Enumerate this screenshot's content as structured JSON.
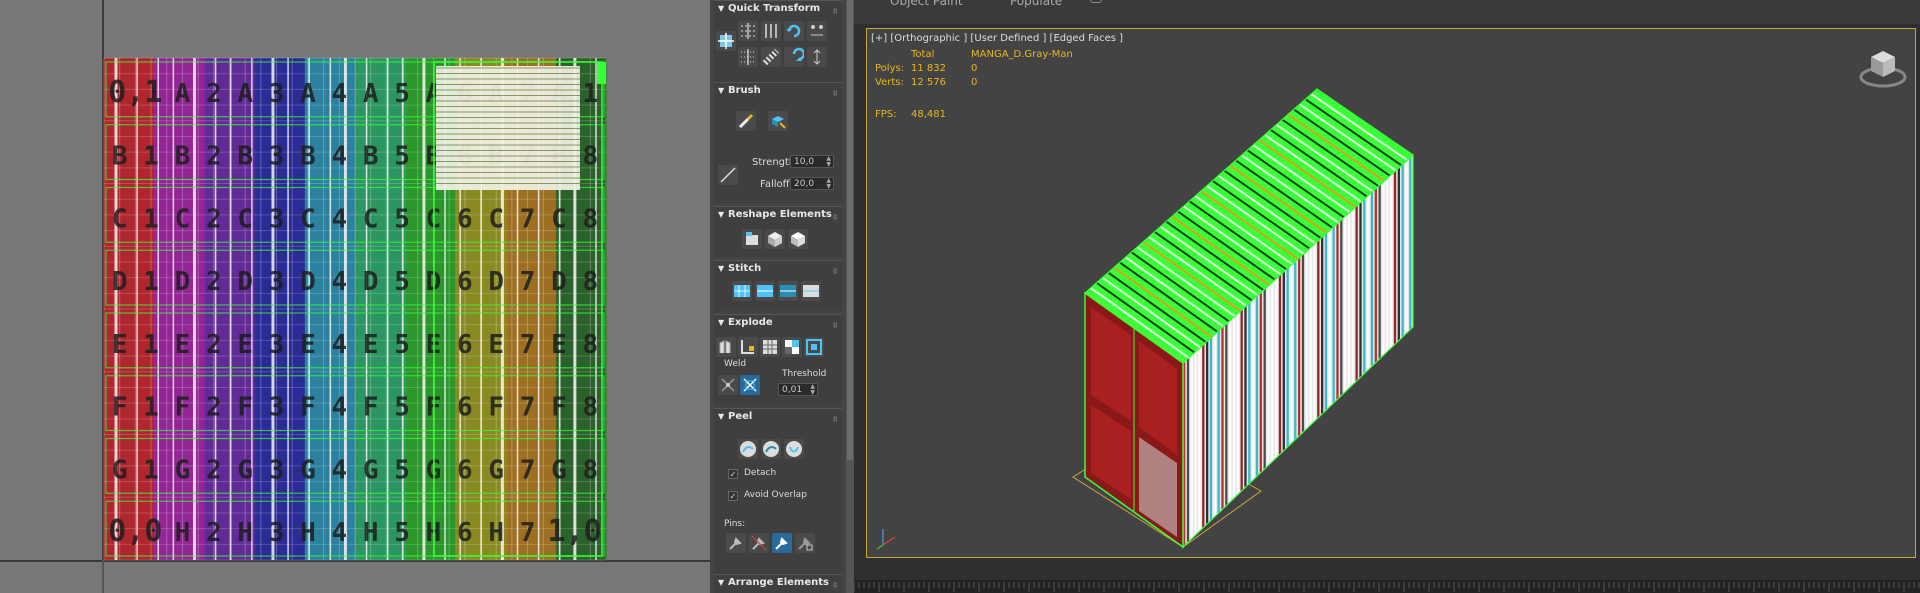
{
  "uv_editor": {
    "rows": [
      {
        "labels": [
          "0,1",
          "A 2",
          "A 3",
          "A 4",
          "A 5",
          "A 6",
          "A 7",
          "A 1"
        ]
      },
      {
        "labels": [
          "B 1",
          "B 2",
          "B 3",
          "B 4",
          "B 5",
          "B 6",
          "B 7",
          "B 8"
        ]
      },
      {
        "labels": [
          "C 1",
          "C 2",
          "C 3",
          "C 4",
          "C 5",
          "C 6",
          "C 7",
          "C 8"
        ]
      },
      {
        "labels": [
          "D 1",
          "D 2",
          "D 3",
          "D 4",
          "D 5",
          "D 6",
          "D 7",
          "D 8"
        ]
      },
      {
        "labels": [
          "E 1",
          "E 2",
          "E 3",
          "E 4",
          "E 5",
          "E 6",
          "E 7",
          "E 8"
        ]
      },
      {
        "labels": [
          "F 1",
          "F 2",
          "F 3",
          "F 4",
          "F 5",
          "F 6",
          "F 7",
          "F 8"
        ]
      },
      {
        "labels": [
          "G 1",
          "G 2",
          "G 3",
          "G 4",
          "G 5",
          "G 6",
          "G 7",
          "G 8"
        ]
      },
      {
        "labels": [
          "0,0",
          "H 2",
          "H 3",
          "H 4",
          "H 5",
          "H 6",
          "H 7",
          "1,0"
        ]
      }
    ],
    "column_colors": [
      "#c4262e",
      "#a423a8",
      "#6a2aa8",
      "#2a2aa8",
      "#2a8fb2",
      "#2aa86a",
      "#2aa82a",
      "#9a9a20",
      "#b07a20",
      "#2a6a2a"
    ]
  },
  "panel": {
    "quick_transform": {
      "title": "Quick Transform"
    },
    "brush": {
      "title": "Brush",
      "strength_label": "Strength:",
      "strength_value": "10,0",
      "falloff_label": "Falloff:",
      "falloff_value": "20,0"
    },
    "reshape": {
      "title": "Reshape Elements"
    },
    "stitch": {
      "title": "Stitch"
    },
    "explode": {
      "title": "Explode",
      "weld_label": "Weld",
      "threshold_label": "Threshold",
      "threshold_value": "0,01"
    },
    "peel": {
      "title": "Peel",
      "detach_label": "Detach",
      "avoid_overlap_label": "Avoid Overlap",
      "pins_label": "Pins:"
    },
    "arrange": {
      "title": "Arrange Elements"
    }
  },
  "top_tabs": [
    "Object Paint",
    "Populate"
  ],
  "viewport": {
    "label": "[+] [Orthographic ] [User Defined ] [Edged Faces ]",
    "stats": {
      "total_header": "Total",
      "object_header": "MANGA_D.Gray-Man",
      "polys_label": "Polys:",
      "polys_total": "11 832",
      "polys_object": "0",
      "verts_label": "Verts:",
      "verts_total": "12 576",
      "verts_object": "0",
      "fps_label": "FPS:",
      "fps_value": "48,481"
    }
  },
  "colors": {
    "accent_yellow": "#e6b820",
    "selection_green": "#39ff39",
    "viewport_bg": "#434343"
  }
}
